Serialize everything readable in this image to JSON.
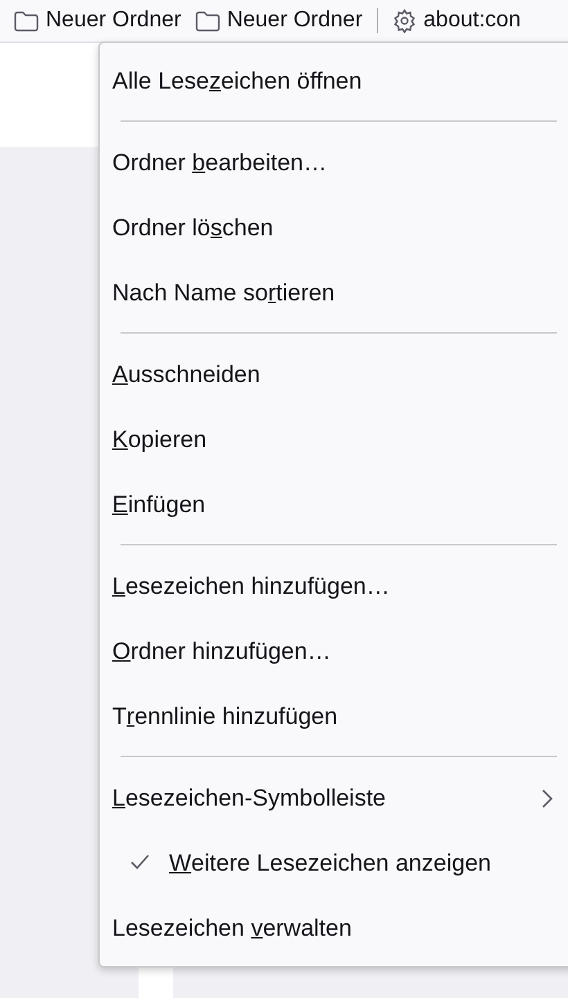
{
  "bookmarks_toolbar": [
    {
      "kind": "folder",
      "label": "Neuer Ordner"
    },
    {
      "kind": "folder",
      "label": "Neuer Ordner"
    },
    {
      "kind": "separator"
    },
    {
      "kind": "page",
      "label": "about:con"
    }
  ],
  "context_menu": [
    {
      "kind": "item",
      "before": "Alle Lese",
      "key": "z",
      "after": "eichen öffnen"
    },
    {
      "kind": "separator"
    },
    {
      "kind": "item",
      "before": "Ordner ",
      "key": "b",
      "after": "earbeiten…"
    },
    {
      "kind": "item",
      "before": "Ordner lö",
      "key": "s",
      "after": "chen"
    },
    {
      "kind": "item",
      "before": "Nach Name so",
      "key": "r",
      "after": "tieren"
    },
    {
      "kind": "separator"
    },
    {
      "kind": "item",
      "key": "A",
      "after": "usschneiden"
    },
    {
      "kind": "item",
      "key": "K",
      "after": "opieren"
    },
    {
      "kind": "item",
      "key": "E",
      "after": "infügen"
    },
    {
      "kind": "separator"
    },
    {
      "kind": "item",
      "key": "L",
      "after": "esezeichen hinzufügen…"
    },
    {
      "kind": "item",
      "key": "O",
      "after": "rdner hinzufügen…"
    },
    {
      "kind": "item",
      "before": "T",
      "key": "r",
      "after": "ennlinie hinzufügen"
    },
    {
      "kind": "separator"
    },
    {
      "kind": "submenu",
      "key": "L",
      "after": "esezeichen-Symbolleiste"
    },
    {
      "kind": "checkbox",
      "checked": true,
      "key": "W",
      "after": "eitere Lesezeichen anzeigen"
    },
    {
      "kind": "item",
      "before": "Lesezeichen ",
      "key": "v",
      "after": "erwalten"
    }
  ]
}
